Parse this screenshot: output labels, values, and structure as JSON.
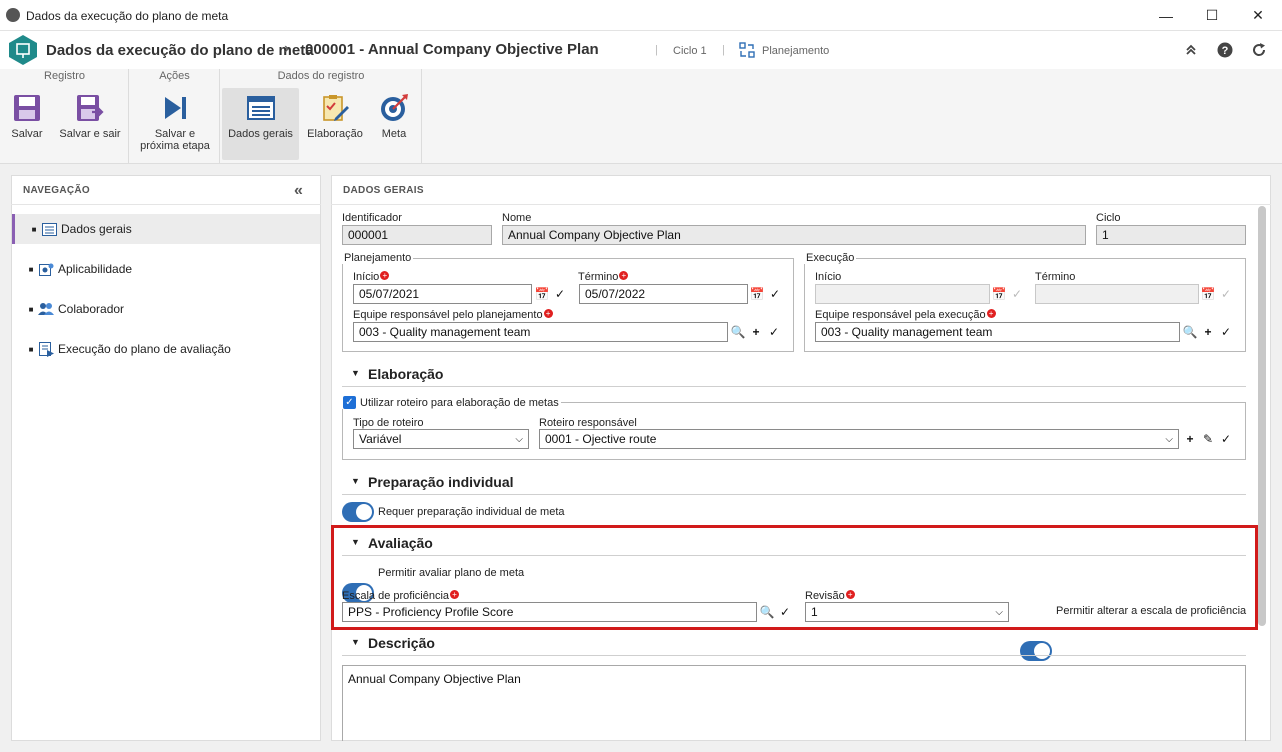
{
  "window": {
    "title": "Dados da execução do plano de meta"
  },
  "header": {
    "title": "Dados da execução do plano de meta",
    "separator": "›",
    "record": "000001 - Annual Company Objective Plan",
    "cycle": "Ciclo 1",
    "status": "Planejamento"
  },
  "ribbon": {
    "groups": {
      "registro": "Registro",
      "acoes": "Ações",
      "dados": "Dados do registro"
    },
    "salvar": "Salvar",
    "salvar_sair": "Salvar e sair",
    "salvar_proxima_1": "Salvar e",
    "salvar_proxima_2": "próxima etapa",
    "dados_gerais": "Dados gerais",
    "elaboracao": "Elaboração",
    "meta": "Meta"
  },
  "nav": {
    "title": "NAVEGAÇÃO",
    "items": [
      "Dados gerais",
      "Aplicabilidade",
      "Colaborador",
      "Execução do plano de avaliação"
    ]
  },
  "main": {
    "title": "DADOS GERAIS",
    "identificador_label": "Identificador",
    "identificador": "000001",
    "nome_label": "Nome",
    "nome": "Annual Company Objective Plan",
    "ciclo_label": "Ciclo",
    "ciclo": "1",
    "planejamento": {
      "legend": "Planejamento",
      "inicio_label": "Início",
      "inicio": "05/07/2021",
      "termino_label": "Término",
      "termino": "05/07/2022",
      "equipe_label": "Equipe responsável pelo planejamento",
      "equipe": "003 - Quality management team"
    },
    "execucao": {
      "legend": "Execução",
      "inicio_label": "Início",
      "termino_label": "Término",
      "equipe_label": "Equipe responsável pela execução",
      "equipe": "003 - Quality management team"
    },
    "elaboracao": {
      "title": "Elaboração",
      "checkbox_label": "Utilizar roteiro para elaboração de metas",
      "tipo_label": "Tipo de roteiro",
      "tipo": "Variável",
      "roteiro_label": "Roteiro responsável",
      "roteiro": "0001 - Ojective route"
    },
    "preparacao": {
      "title": "Preparação individual",
      "toggle_label": "Requer preparação individual de meta"
    },
    "avaliacao": {
      "title": "Avaliação",
      "toggle_label": "Permitir avaliar plano de meta",
      "escala_label": "Escala de proficiência",
      "escala": "PPS - Proficiency Profile Score",
      "revisao_label": "Revisão",
      "revisao": "1",
      "alterar_label": "Permitir alterar a escala de proficiência"
    },
    "descricao": {
      "title": "Descrição",
      "text": "Annual Company Objective Plan"
    }
  },
  "colors": {
    "accent": "#2f6eb5",
    "highlight": "#d11a1a",
    "nav_selected": "#8a5fb3"
  }
}
